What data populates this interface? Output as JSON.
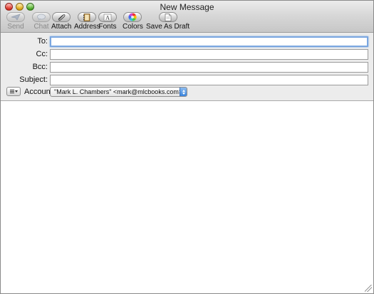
{
  "window": {
    "title": "New Message"
  },
  "toolbar": {
    "send": "Send",
    "chat": "Chat",
    "attach": "Attach",
    "address": "Address",
    "fonts": "Fonts",
    "colors": "Colors",
    "save_draft": "Save As Draft"
  },
  "fields": {
    "to_label": "To:",
    "to_value": "",
    "cc_label": "Cc:",
    "cc_value": "",
    "bcc_label": "Bcc:",
    "bcc_value": "",
    "subject_label": "Subject:",
    "subject_value": "",
    "account_label": "Account:",
    "account_value": "\"Mark L. Chambers\" <mark@mlcbooks.com>"
  },
  "message": {
    "body": ""
  },
  "icons": [
    "send-icon",
    "chat-icon",
    "attach-icon",
    "address-book-icon",
    "fonts-icon",
    "colors-icon",
    "draft-icon"
  ],
  "colors": {
    "focus_ring": "#7aa6e0",
    "popup_accent": "#3a84dc"
  }
}
